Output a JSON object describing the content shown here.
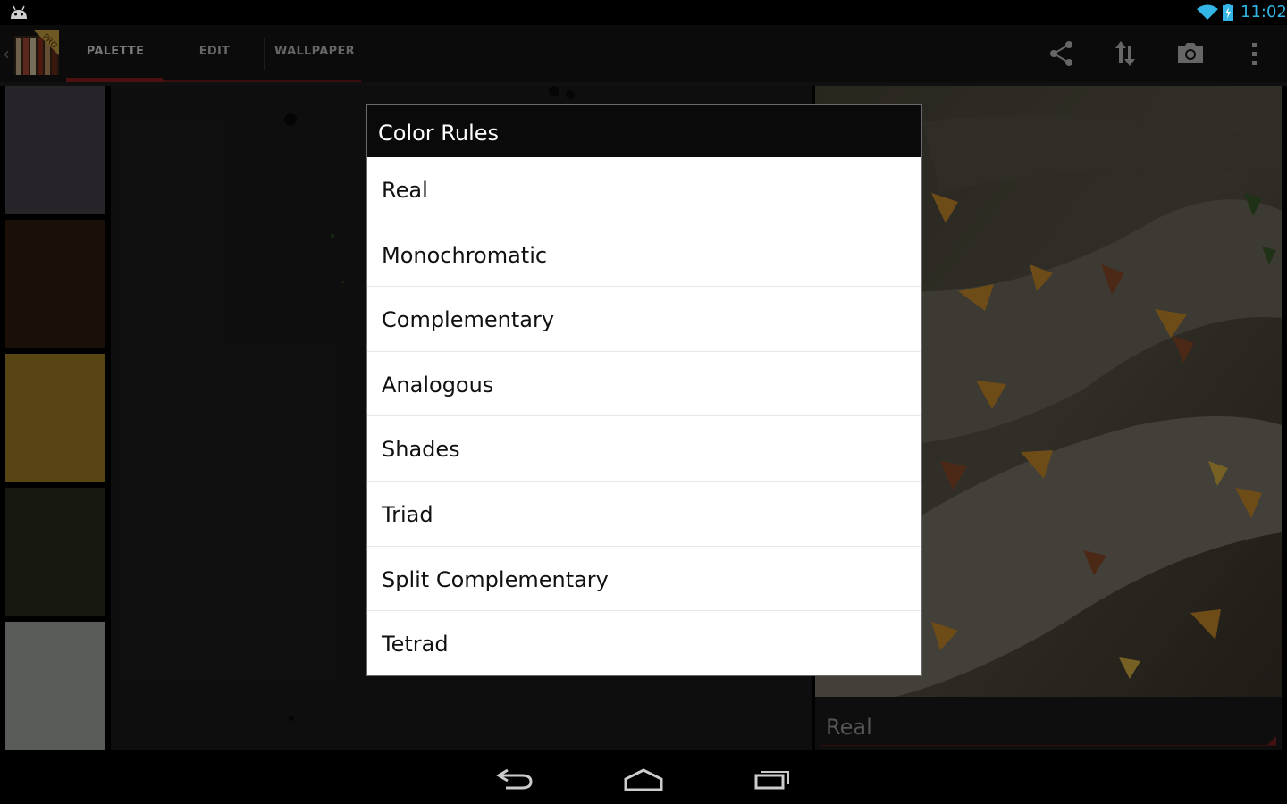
{
  "status_bar": {
    "time": "11:02",
    "accent": "#33b5e5"
  },
  "action_bar": {
    "logo_badge": "PRO",
    "tabs": [
      {
        "label": "PALETTE",
        "selected": true
      },
      {
        "label": "EDIT",
        "selected": false
      },
      {
        "label": "WALLPAPER",
        "selected": false
      }
    ],
    "actions": [
      "share-icon",
      "sort-icon",
      "camera-icon",
      "overflow-menu-icon"
    ],
    "accent": "#8b1e1e"
  },
  "palette": {
    "swatches": [
      "#46424a",
      "#321c12",
      "#a27c26",
      "#2a2c1c",
      "#a2a6a2"
    ]
  },
  "rule_spinner": {
    "value": "Real"
  },
  "dialog": {
    "title": "Color Rules",
    "items": [
      "Real",
      "Monochromatic",
      "Complementary",
      "Analogous",
      "Shades",
      "Triad",
      "Split Complementary",
      "Tetrad"
    ]
  },
  "nav_bar": {
    "buttons": [
      "back-icon",
      "home-icon",
      "recents-icon"
    ]
  }
}
